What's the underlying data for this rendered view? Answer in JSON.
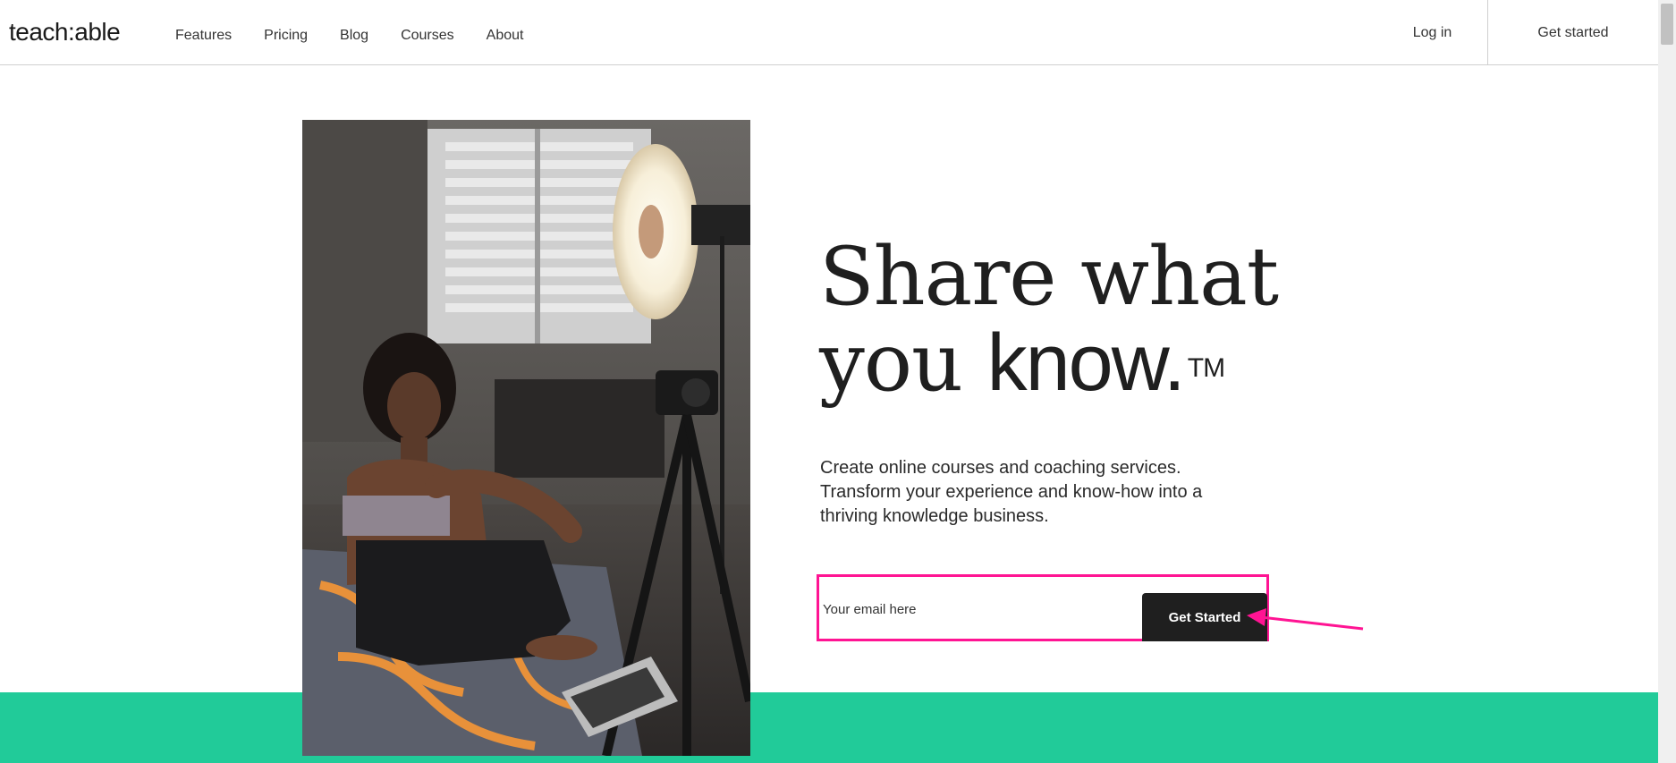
{
  "header": {
    "logo_text": "teach:able",
    "nav": [
      {
        "label": "Features"
      },
      {
        "label": "Pricing"
      },
      {
        "label": "Blog"
      },
      {
        "label": "Courses"
      },
      {
        "label": "About"
      }
    ],
    "login_label": "Log in",
    "get_started_label": "Get started"
  },
  "hero": {
    "headline_line1": "Share what",
    "headline_line2_prefix": "you ",
    "headline_line2_emphasis": "know.",
    "headline_trademark": "TM",
    "subhead": "Create online courses and coaching services. Transform your experience and know-how into a thriving knowledge business.",
    "email_placeholder": "Your email here",
    "submit_label": "Get Started",
    "photo_icon": "creator-filming-photo"
  },
  "colors": {
    "accent_green": "#21cb99",
    "highlight_pink": "#ff1493",
    "button_dark": "#1f1f1f"
  }
}
